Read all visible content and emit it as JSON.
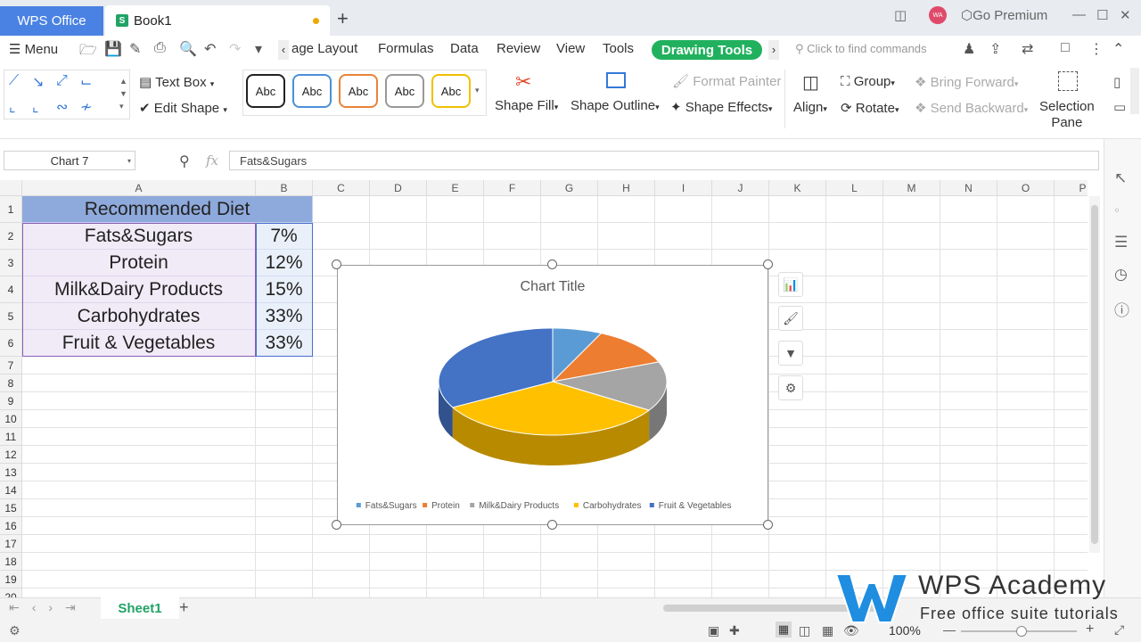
{
  "titlebar": {
    "app_tab": "WPS Office",
    "doc_tab": "Book1",
    "go_premium": "Go Premium",
    "avatar_initials": "WA"
  },
  "menubar": {
    "menu_label": "Menu",
    "tabs": [
      "age Layout",
      "Formulas",
      "Data",
      "Review",
      "View",
      "Tools"
    ],
    "active_tab": "Drawing Tools",
    "search_placeholder": "Click to find commands"
  },
  "ribbon": {
    "text_box": "Text Box",
    "edit_shape": "Edit Shape",
    "style_samples": [
      "Abc",
      "Abc",
      "Abc",
      "Abc",
      "Abc"
    ],
    "style_colors": [
      "#222222",
      "#4a90d9",
      "#e8833a",
      "#999999",
      "#f0c000"
    ],
    "shape_fill": "Shape Fill",
    "shape_outline": "Shape Outline",
    "format_painter": "Format Painter",
    "shape_effects": "Shape Effects",
    "align": "Align",
    "group": "Group",
    "rotate": "Rotate",
    "bring_forward": "Bring Forward",
    "send_backward": "Send Backward",
    "selection_pane_1": "Selection",
    "selection_pane_2": "Pane"
  },
  "formula": {
    "name_box": "Chart 7",
    "fx": "fx",
    "content": "Fats&Sugars"
  },
  "grid": {
    "columns": [
      "A",
      "B",
      "C",
      "D",
      "E",
      "F",
      "G",
      "H",
      "I",
      "J",
      "K",
      "L",
      "M",
      "N",
      "O",
      "P"
    ],
    "rows": [
      "1",
      "2",
      "3",
      "4",
      "5",
      "6",
      "7",
      "8",
      "9",
      "10",
      "11",
      "12",
      "13",
      "14",
      "15",
      "16",
      "17",
      "18",
      "19",
      "20"
    ],
    "header_cell": "Recommended Diet",
    "table": [
      {
        "label": "Fats&Sugars",
        "value": "7%"
      },
      {
        "label": "Protein",
        "value": "12%"
      },
      {
        "label": "Milk&Dairy Products",
        "value": "15%"
      },
      {
        "label": "Carbohydrates",
        "value": "33%"
      },
      {
        "label": "Fruit & Vegetables",
        "value": "33%"
      }
    ]
  },
  "chart_data": {
    "type": "pie",
    "title": "Chart Title",
    "categories": [
      "Fats&Sugars",
      "Protein",
      "Milk&Dairy Products",
      "Carbohydrates",
      "Fruit & Vegetables"
    ],
    "values": [
      7,
      12,
      15,
      33,
      33
    ],
    "colors": [
      "#5b9bd5",
      "#ed7d31",
      "#a5a5a5",
      "#ffc000",
      "#4472c4"
    ],
    "legend_position": "bottom",
    "style": "3d"
  },
  "sheetbar": {
    "sheet_tab": "Sheet1"
  },
  "status": {
    "zoom": "100%"
  },
  "watermark": {
    "brand": "WPS Academy",
    "tagline": "Free office suite tutorials"
  }
}
